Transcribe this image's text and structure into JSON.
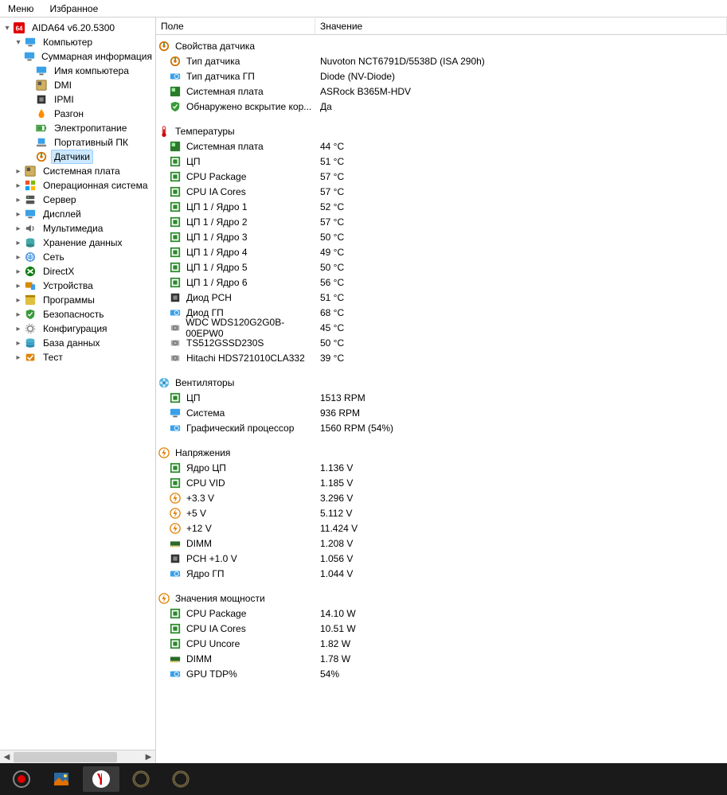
{
  "menubar": {
    "menu": "Меню",
    "favorites": "Избранное"
  },
  "app_title": "AIDA64 v6.20.5300",
  "tree": {
    "root": {
      "label": "Компьютер",
      "children": [
        {
          "label": "Суммарная информация",
          "icon": "monitor"
        },
        {
          "label": "Имя компьютера",
          "icon": "monitor"
        },
        {
          "label": "DMI",
          "icon": "board"
        },
        {
          "label": "IPMI",
          "icon": "chip-dark"
        },
        {
          "label": "Разгон",
          "icon": "flame"
        },
        {
          "label": "Электропитание",
          "icon": "battery"
        },
        {
          "label": "Портативный ПК",
          "icon": "laptop"
        },
        {
          "label": "Датчики",
          "icon": "sensor",
          "selected": true
        }
      ]
    },
    "siblings": [
      {
        "label": "Системная плата",
        "icon": "board",
        "expandable": true
      },
      {
        "label": "Операционная система",
        "icon": "windows",
        "expandable": true
      },
      {
        "label": "Сервер",
        "icon": "server",
        "expandable": true
      },
      {
        "label": "Дисплей",
        "icon": "monitor",
        "expandable": true
      },
      {
        "label": "Мультимедиа",
        "icon": "speaker",
        "expandable": true
      },
      {
        "label": "Хранение данных",
        "icon": "disk",
        "expandable": true
      },
      {
        "label": "Сеть",
        "icon": "network",
        "expandable": true
      },
      {
        "label": "DirectX",
        "icon": "directx",
        "expandable": true
      },
      {
        "label": "Устройства",
        "icon": "devices",
        "expandable": true
      },
      {
        "label": "Программы",
        "icon": "apps",
        "expandable": true
      },
      {
        "label": "Безопасность",
        "icon": "shield",
        "expandable": true
      },
      {
        "label": "Конфигурация",
        "icon": "gear",
        "expandable": true
      },
      {
        "label": "База данных",
        "icon": "database",
        "expandable": true
      },
      {
        "label": "Тест",
        "icon": "test",
        "expandable": true
      }
    ]
  },
  "columns": {
    "field_width": 200,
    "field": "Поле",
    "value": "Значение"
  },
  "sections": [
    {
      "title": "Свойства датчика",
      "title_icon": "sensor",
      "rows": [
        {
          "icon": "sensor",
          "field": "Тип датчика",
          "value": "Nuvoton NCT6791D/5538D  (ISA 290h)"
        },
        {
          "icon": "gpu",
          "field": "Тип датчика ГП",
          "value": "Diode  (NV-Diode)"
        },
        {
          "icon": "board-green",
          "field": "Системная плата",
          "value": "ASRock B365M-HDV"
        },
        {
          "icon": "shield",
          "field": "Обнаружено вскрытие кор...",
          "value": "Да"
        }
      ]
    },
    {
      "title": "Температуры",
      "title_icon": "thermo",
      "rows": [
        {
          "icon": "board-green",
          "field": "Системная плата",
          "value": "44 °C"
        },
        {
          "icon": "chip",
          "field": "ЦП",
          "value": "51 °C"
        },
        {
          "icon": "chip",
          "field": "CPU Package",
          "value": "57 °C"
        },
        {
          "icon": "chip",
          "field": "CPU IA Cores",
          "value": "57 °C"
        },
        {
          "icon": "chip",
          "field": "ЦП 1 / Ядро 1",
          "value": "52 °C"
        },
        {
          "icon": "chip",
          "field": "ЦП 1 / Ядро 2",
          "value": "57 °C"
        },
        {
          "icon": "chip",
          "field": "ЦП 1 / Ядро 3",
          "value": "50 °C"
        },
        {
          "icon": "chip",
          "field": "ЦП 1 / Ядро 4",
          "value": "49 °C"
        },
        {
          "icon": "chip",
          "field": "ЦП 1 / Ядро 5",
          "value": "50 °C"
        },
        {
          "icon": "chip",
          "field": "ЦП 1 / Ядро 6",
          "value": "56 °C"
        },
        {
          "icon": "chip-dark",
          "field": "Диод PCH",
          "value": "51 °C"
        },
        {
          "icon": "gpu",
          "field": "Диод ГП",
          "value": "68 °C"
        },
        {
          "icon": "hdd",
          "field": "WDC WDS120G2G0B-00EPW0",
          "value": "45 °C"
        },
        {
          "icon": "hdd",
          "field": "TS512GSSD230S",
          "value": "50 °C"
        },
        {
          "icon": "hdd",
          "field": "Hitachi HDS721010CLA332",
          "value": "39 °C"
        }
      ]
    },
    {
      "title": "Вентиляторы",
      "title_icon": "fan",
      "rows": [
        {
          "icon": "chip",
          "field": "ЦП",
          "value": "1513 RPM"
        },
        {
          "icon": "monitor",
          "field": "Система",
          "value": "936 RPM"
        },
        {
          "icon": "gpu",
          "field": "Графический процессор",
          "value": "1560 RPM  (54%)"
        }
      ]
    },
    {
      "title": "Напряжения",
      "title_icon": "bolt",
      "rows": [
        {
          "icon": "chip",
          "field": "Ядро ЦП",
          "value": "1.136 V"
        },
        {
          "icon": "chip",
          "field": "CPU VID",
          "value": "1.185 V"
        },
        {
          "icon": "bolt",
          "field": "+3.3 V",
          "value": "3.296 V"
        },
        {
          "icon": "bolt",
          "field": "+5 V",
          "value": "5.112 V"
        },
        {
          "icon": "bolt",
          "field": "+12 V",
          "value": "11.424 V"
        },
        {
          "icon": "ram",
          "field": "DIMM",
          "value": "1.208 V"
        },
        {
          "icon": "chip-dark",
          "field": "PCH +1.0 V",
          "value": "1.056 V"
        },
        {
          "icon": "gpu",
          "field": "Ядро ГП",
          "value": "1.044 V"
        }
      ]
    },
    {
      "title": "Значения мощности",
      "title_icon": "bolt",
      "rows": [
        {
          "icon": "chip",
          "field": "CPU Package",
          "value": "14.10 W"
        },
        {
          "icon": "chip",
          "field": "CPU IA Cores",
          "value": "10.51 W"
        },
        {
          "icon": "chip",
          "field": "CPU Uncore",
          "value": "1.82 W"
        },
        {
          "icon": "ram",
          "field": "DIMM",
          "value": "1.78 W"
        },
        {
          "icon": "gpu",
          "field": "GPU TDP%",
          "value": "54%"
        }
      ]
    }
  ],
  "taskbar": [
    {
      "icon": "record",
      "active": false
    },
    {
      "icon": "picture",
      "active": false
    },
    {
      "icon": "yandex",
      "active": true
    },
    {
      "icon": "ring",
      "active": false
    },
    {
      "icon": "ring",
      "active": false
    }
  ]
}
